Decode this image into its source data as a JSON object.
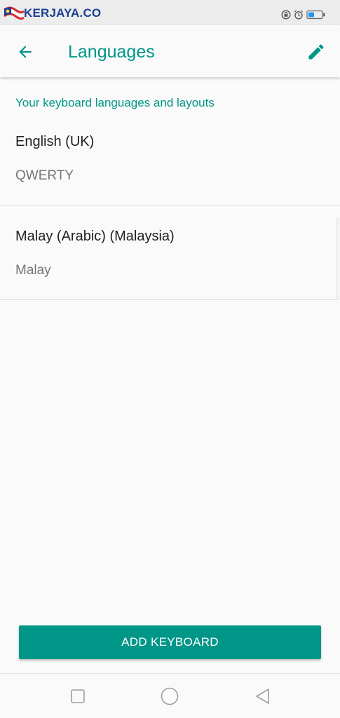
{
  "status_bar": {
    "watermark_text": "KERJAYA.CO",
    "icons": [
      "lock-rotation-icon",
      "alarm-icon",
      "battery-icon"
    ],
    "battery_color": "#2196f3"
  },
  "app_bar": {
    "title": "Languages",
    "back_icon": "arrow-back-icon",
    "edit_icon": "pencil-icon"
  },
  "content": {
    "section_header": "Your keyboard languages and layouts",
    "languages": [
      {
        "name": "English (UK)",
        "layout": "QWERTY"
      },
      {
        "name": "Malay (Arabic) (Malaysia)",
        "layout": "Malay"
      }
    ]
  },
  "actions": {
    "add_keyboard_label": "ADD KEYBOARD"
  },
  "nav_bar": {
    "icons": [
      "recent-apps-icon",
      "home-icon",
      "back-triangle-icon"
    ]
  },
  "colors": {
    "accent": "#009688",
    "text_primary": "#212121",
    "text_secondary": "#757575",
    "background": "#fafafa"
  }
}
